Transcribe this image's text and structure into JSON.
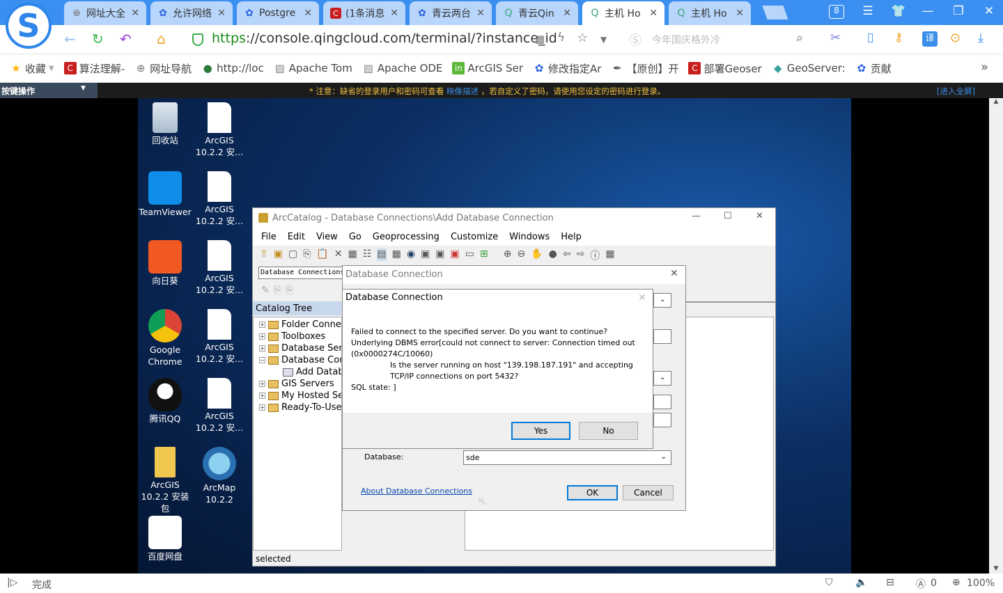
{
  "browser": {
    "tabs": [
      {
        "label": "网址大全",
        "icon": "globe-icon",
        "color": "#777"
      },
      {
        "label": "允许网络",
        "icon": "baidu-icon",
        "color": "#2a62e0"
      },
      {
        "label": "Postgre",
        "icon": "baidu-icon",
        "color": "#2a62e0"
      },
      {
        "label": "(1条消息",
        "icon": "csdn-icon",
        "color": "#c81e1e"
      },
      {
        "label": "青云两台",
        "icon": "baidu-icon",
        "color": "#2a62e0"
      },
      {
        "label": "青云Qin",
        "icon": "qingcloud-icon",
        "color": "#3aa37a"
      },
      {
        "label": "主机 Ho",
        "icon": "qingcloud-icon",
        "color": "#3aa37a",
        "active": true
      },
      {
        "label": "主机 Ho",
        "icon": "qingcloud-icon",
        "color": "#3aa37a"
      }
    ],
    "tab_count_badge": "8",
    "url_scheme": "https",
    "url_rest": "://console.qingcloud.com/terminal/?instance_id",
    "search_placeholder": "今年国庆格外冷",
    "bookmarks": [
      {
        "label": "收藏",
        "icon": "star-icon",
        "color": "#f5b400"
      },
      {
        "label": "算法理解-",
        "icon": "csdn-icon",
        "color": "#c81e1e"
      },
      {
        "label": "网址导航",
        "icon": "globe-icon",
        "color": "#777"
      },
      {
        "label": "http://loc",
        "icon": "earth-icon",
        "color": "#2a7a3a"
      },
      {
        "label": "Apache Tom",
        "icon": "image-icon",
        "color": "#888"
      },
      {
        "label": "Apache ODE",
        "icon": "image-icon",
        "color": "#888"
      },
      {
        "label": "ArcGIS Ser",
        "icon": "in-icon",
        "color": "#5cb83a"
      },
      {
        "label": "修改指定Ar",
        "icon": "baidu-icon",
        "color": "#2a62e0"
      },
      {
        "label": "【原创】开",
        "icon": "pen-icon",
        "color": "#555"
      },
      {
        "label": "部署Geoser",
        "icon": "csdn-icon",
        "color": "#c81e1e"
      },
      {
        "label": "GeoServer:",
        "icon": "geoserver-icon",
        "color": "#3aa3a0"
      },
      {
        "label": "贡献",
        "icon": "baidu-icon",
        "color": "#2a62e0"
      }
    ],
    "status_text": "完成",
    "zoom": "100%",
    "download_count": "0"
  },
  "remote": {
    "key_ops": "按键操作",
    "notice_pre": "* 注意：缺省的登录用户和密码可查看 ",
    "notice_link": "映像描述",
    "notice_post": " ，若自定义了密码，请使用您设定的密码进行登录。",
    "fullscreen": "[进入全屏]"
  },
  "desktop": {
    "icons": [
      {
        "label": "回收站",
        "kind": "recycle"
      },
      {
        "label": "ArcGIS 10.2.2 安...",
        "kind": "doc"
      },
      {
        "label": "TeamViewer",
        "kind": "teamviewer"
      },
      {
        "label": "ArcGIS 10.2.2 安...",
        "kind": "doc"
      },
      {
        "label": "向日葵",
        "kind": "sunflower"
      },
      {
        "label": "ArcGIS 10.2.2 安...",
        "kind": "doc"
      },
      {
        "label": "Google Chrome",
        "kind": "chrome"
      },
      {
        "label": "ArcGIS 10.2.2 安...",
        "kind": "doc"
      },
      {
        "label": "腾讯QQ",
        "kind": "qq"
      },
      {
        "label": "ArcGIS 10.2.2 安...",
        "kind": "doc"
      },
      {
        "label": "ArcGIS 10.2.2 安装包",
        "kind": "folder"
      },
      {
        "label": "ArcMap 10.2.2",
        "kind": "arcmap"
      },
      {
        "label": "百度网盘",
        "kind": "baidupan"
      }
    ]
  },
  "arccatalog": {
    "title": "ArcCatalog - Database Connections\\Add Database Connection",
    "menu": [
      "File",
      "Edit",
      "View",
      "Go",
      "Geoprocessing",
      "Customize",
      "Windows",
      "Help"
    ],
    "location": "Database Connections",
    "catalog_tree_title": "Catalog Tree",
    "tree": [
      {
        "label": "Folder Connections",
        "exp": "+"
      },
      {
        "label": "Toolboxes",
        "exp": "+"
      },
      {
        "label": "Database Servers",
        "exp": "+"
      },
      {
        "label": "Database Connections",
        "exp": "−"
      },
      {
        "label": "Add Database Connection",
        "exp": "",
        "child": true
      },
      {
        "label": "GIS Servers",
        "exp": "+"
      },
      {
        "label": "My Hosted Services",
        "exp": "+"
      },
      {
        "label": "Ready-To-Use Services",
        "exp": "+"
      }
    ],
    "status": "selected"
  },
  "db_dialog": {
    "title": "Database Connection",
    "database_label": "Database:",
    "database_value": "sde",
    "about_link": "About Database Connections",
    "ok": "OK",
    "cancel": "Cancel"
  },
  "error_dialog": {
    "title": "Database Connection",
    "lines": [
      "Failed to connect to the specified server. Do you want to continue?",
      "Underlying DBMS error[could not connect to server: Connection timed out",
      "(0x0000274C/10060)",
      "Is the server running on host \"139.198.187.191\" and accepting",
      "TCP/IP connections on port 5432?",
      "SQL state: ]"
    ],
    "yes": "Yes",
    "no": "No"
  }
}
